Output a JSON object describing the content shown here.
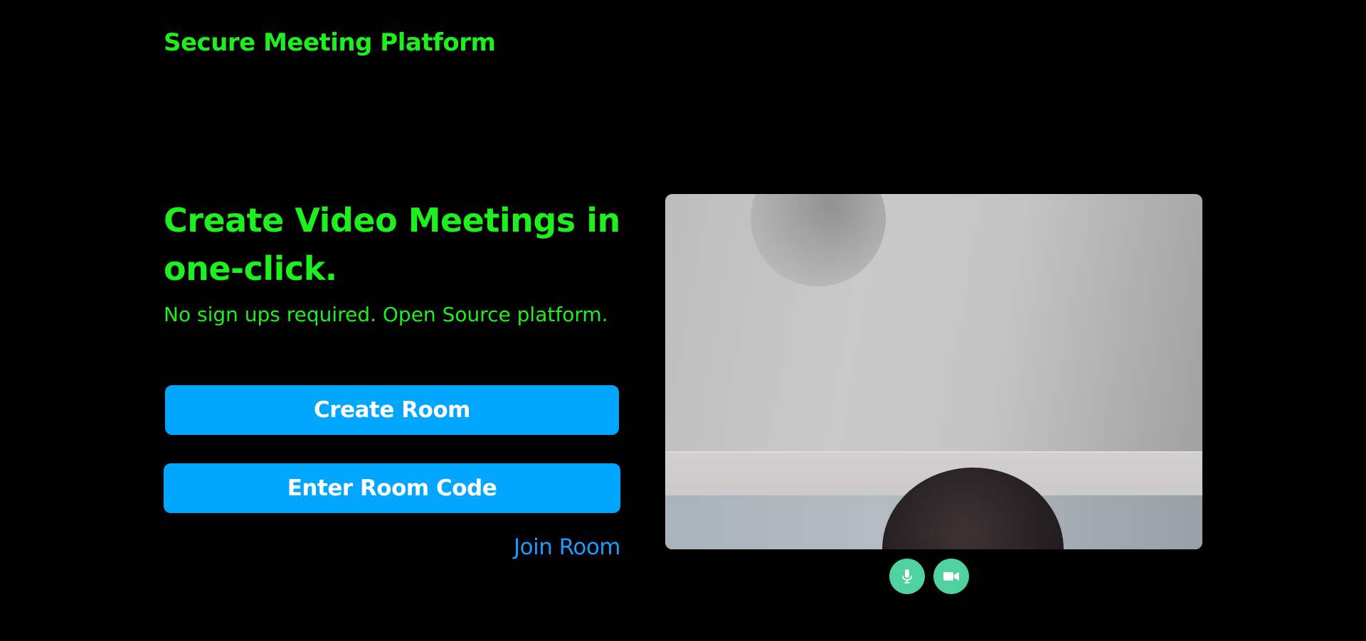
{
  "header": {
    "brand": "Secure Meeting Platform"
  },
  "hero": {
    "headline": "Create Video Meetings in one-click.",
    "subline": "No sign ups required. Open Source platform."
  },
  "actions": {
    "create_room": "Create Room",
    "enter_room_code": "Enter Room Code",
    "join_room": "Join Room"
  },
  "preview": {
    "controls": [
      {
        "icon": "microphone-icon"
      },
      {
        "icon": "video-camera-icon"
      }
    ]
  },
  "colors": {
    "background": "#000000",
    "brand_green": "#1ef01e",
    "button_blue": "#00a6ff",
    "link_blue": "#1a9bff",
    "control_green": "#4fd1a0"
  }
}
